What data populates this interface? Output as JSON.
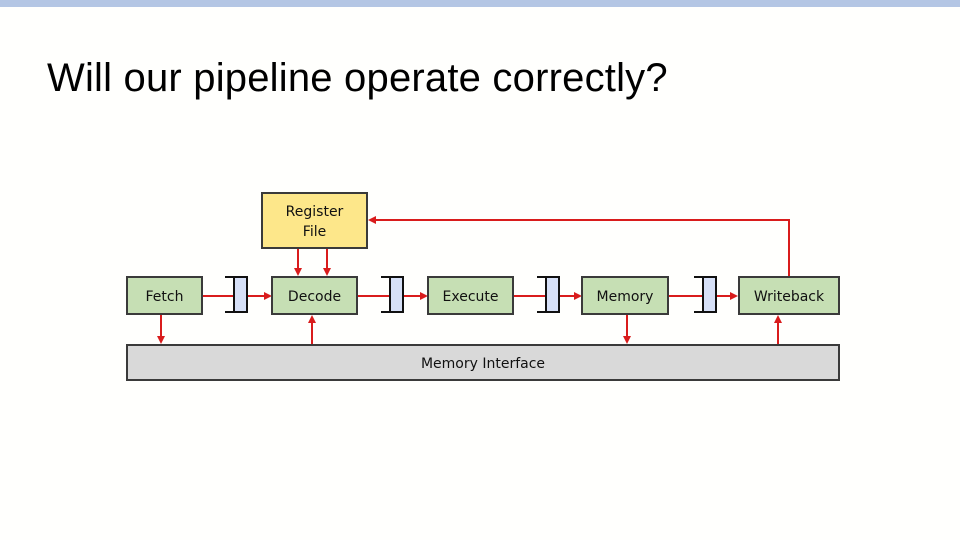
{
  "slide": {
    "title": "Will our pipeline operate correctly?"
  },
  "colors": {
    "top_bar": "#b4c6e4",
    "stage_fill": "#c6dfb4",
    "register_file_fill": "#fde78a",
    "latch_fill": "#d6e0f7",
    "memory_interface_fill": "#d9d9d9",
    "arrow": "#d91c1c",
    "border": "#3a3a3a"
  },
  "diagram": {
    "register_file": {
      "line1": "Register",
      "line2": "File"
    },
    "stages": [
      {
        "id": "fetch",
        "label": "Fetch"
      },
      {
        "id": "decode",
        "label": "Decode"
      },
      {
        "id": "execute",
        "label": "Execute"
      },
      {
        "id": "memory",
        "label": "Memory"
      },
      {
        "id": "writeback",
        "label": "Writeback"
      }
    ],
    "pipeline_registers": 4,
    "memory_interface": {
      "label": "Memory Interface"
    }
  }
}
